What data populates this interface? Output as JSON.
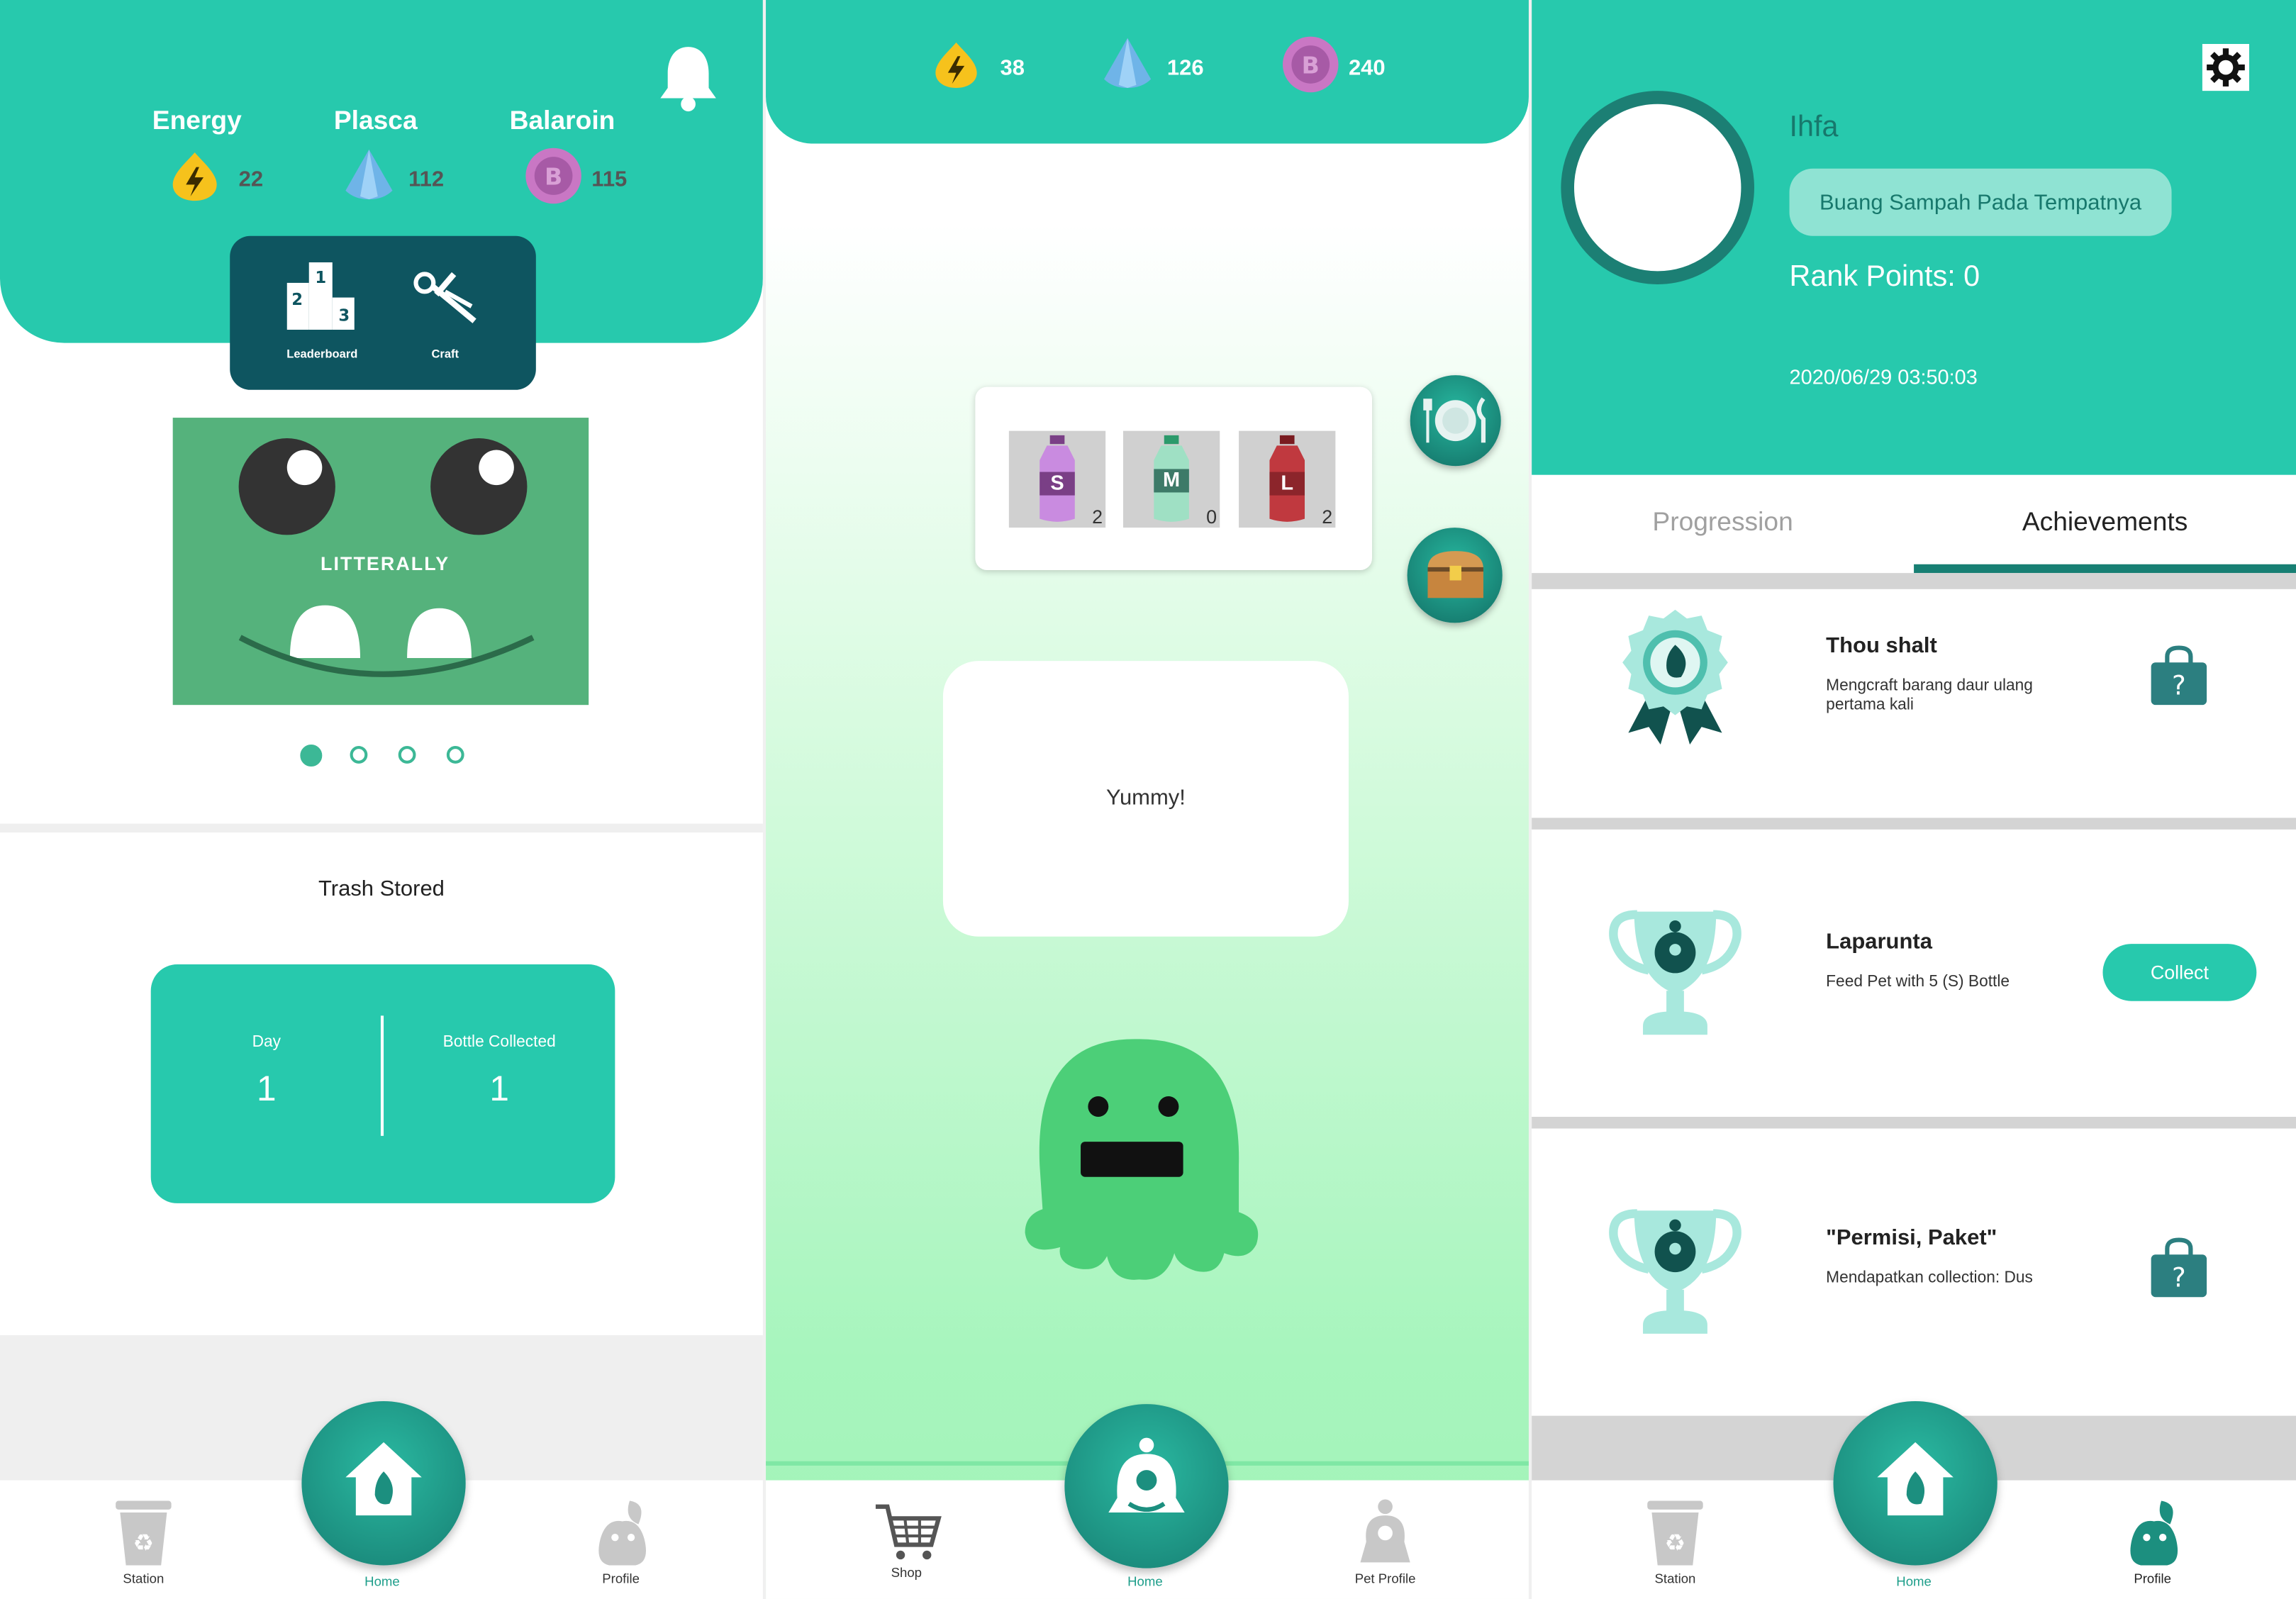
{
  "home": {
    "resources": [
      {
        "label": "Energy",
        "value": "22",
        "icon": "energy-icon"
      },
      {
        "label": "Plasca",
        "value": "112",
        "icon": "plasca-crystal-icon"
      },
      {
        "label": "Balaroin",
        "value": "115",
        "icon": "balaroin-coin-icon"
      }
    ],
    "menu": [
      {
        "label": "Leaderboard",
        "icon": "leaderboard-podium-icon"
      },
      {
        "label": "Craft",
        "icon": "craft-scissors-icon"
      }
    ],
    "banner_text": "LITTERALLY",
    "carousel_pages": 4,
    "trash_title": "Trash Stored",
    "stats": [
      {
        "label": "Day",
        "value": "1"
      },
      {
        "label": "Bottle Collected",
        "value": "1"
      }
    ],
    "nav": {
      "left": "Station",
      "center": "Home",
      "right": "Profile"
    }
  },
  "pet": {
    "resources": [
      {
        "value": "38",
        "icon": "energy-icon"
      },
      {
        "value": "126",
        "icon": "plasca-crystal-icon"
      },
      {
        "value": "240",
        "icon": "balaroin-coin-icon"
      }
    ],
    "bottles": [
      {
        "size": "S",
        "count": "2",
        "color": "#c98be0"
      },
      {
        "size": "M",
        "count": "0",
        "color": "#9fe0c4"
      },
      {
        "size": "L",
        "count": "2",
        "color": "#c0393f"
      }
    ],
    "speech": "Yummy!",
    "nav": {
      "left": "Shop",
      "center": "Home",
      "right": "Pet Profile"
    }
  },
  "profile": {
    "username": "Ihfa",
    "motto": "Buang Sampah Pada Tempatnya",
    "rank_points": "Rank Points: 0",
    "timestamp": "2020/06/29 03:50:03",
    "tabs": {
      "progression": "Progression",
      "achievements": "Achievements"
    },
    "achievements": [
      {
        "title": "Thou shalt",
        "desc": "Mengcraft barang daur ulang pertama kali",
        "status": "locked"
      },
      {
        "title": "Laparunta",
        "desc": "Feed Pet with 5 (S) Bottle",
        "status": "Collect"
      },
      {
        "title": "\"Permisi, Paket\"",
        "desc": "Mendapatkan collection: Dus",
        "status": "locked"
      }
    ],
    "nav": {
      "left": "Station",
      "center": "Home",
      "right": "Profile"
    }
  },
  "colors": {
    "teal": "#27c9ad",
    "dark_teal": "#0e5560",
    "pet_green": "#4ccf78"
  }
}
